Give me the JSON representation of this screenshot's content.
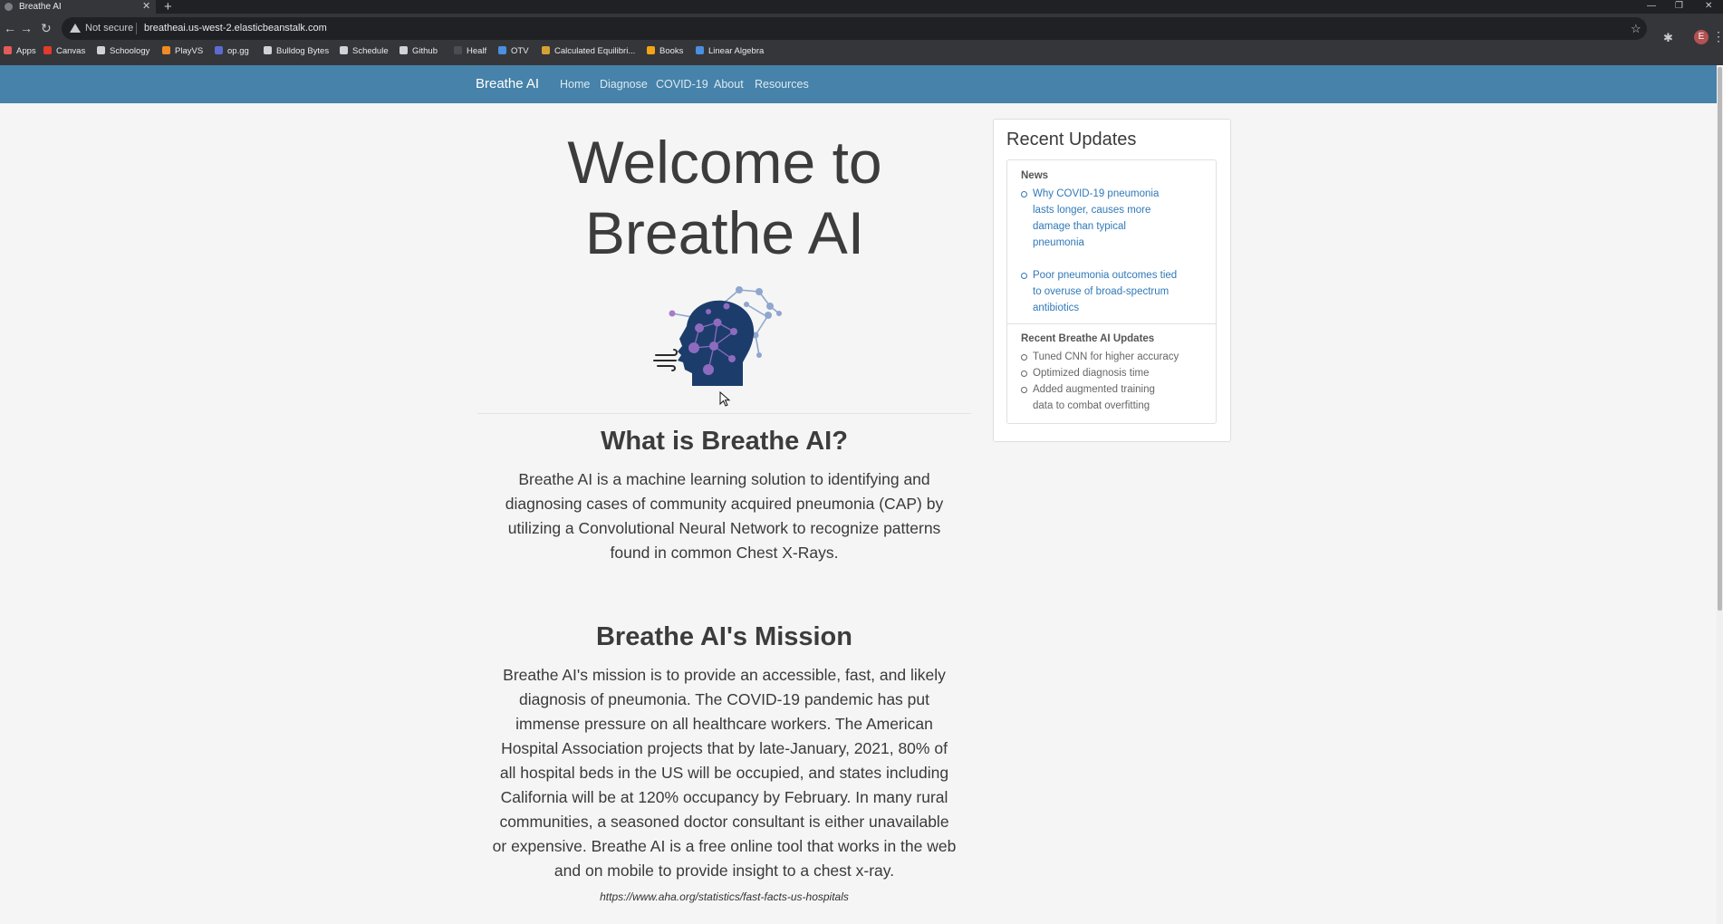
{
  "browser": {
    "tab_title": "Breathe AI",
    "tab_close": "✕",
    "new_tab": "+",
    "url_warning": "Not secure",
    "url": "breatheai.us-west-2.elasticbeanstalk.com",
    "profile_initial": "E",
    "bookmarks": [
      {
        "label": "Apps",
        "color": "#e45b5b"
      },
      {
        "label": "Canvas",
        "color": "#e13b2c"
      },
      {
        "label": "Schoology",
        "color": "#cfd3d8"
      },
      {
        "label": "PlayVS",
        "color": "#f08a24"
      },
      {
        "label": "op.gg",
        "color": "#5d6bd1"
      },
      {
        "label": "Bulldog Bytes",
        "color": "#cfd3d8"
      },
      {
        "label": "Schedule",
        "color": "#cfd3d8"
      },
      {
        "label": "Github",
        "color": "#cfd3d8"
      },
      {
        "label": "Healf",
        "color": "#4a4d52"
      },
      {
        "label": "OTV",
        "color": "#4a8fe0"
      },
      {
        "label": "Calculated Equilibri...",
        "color": "#d6a134"
      },
      {
        "label": "Books",
        "color": "#f2a516"
      },
      {
        "label": "Linear Algebra",
        "color": "#4a8fe0"
      }
    ]
  },
  "nav": {
    "brand": "Breathe AI",
    "links": [
      "Home",
      "Diagnose",
      "COVID-19",
      "About",
      "Resources"
    ]
  },
  "hero": {
    "line1": "Welcome to",
    "line2": "Breathe AI"
  },
  "what": {
    "title": "What is Breathe AI?",
    "lines": [
      "Breathe AI is a machine learning solution to identifying and",
      "diagnosing cases of community acquired pneumonia (CAP) by",
      "utilizing a Convolutional Neural Network to recognize patterns",
      "found in common Chest X-Rays."
    ]
  },
  "mission": {
    "title": "Breathe AI's Mission",
    "lines": [
      "Breathe AI's mission is to provide an accessible, fast, and likely",
      "diagnosis of pneumonia. The COVID-19 pandemic has put",
      "immense pressure on all healthcare workers. The American",
      "Hospital Association projects that by late-January, 2021, 80% of",
      "all hospital beds in the US will be occupied, and states including",
      "California will be at 120% occupancy by February. In many rural",
      "communities, a seasoned doctor consultant is either unavailable",
      "or expensive. Breathe AI is a free online tool that works in the web",
      "and on mobile to provide insight to a chest x-ray."
    ],
    "citation": "https://www.aha.org/statistics/fast-facts-us-hospitals"
  },
  "updates": {
    "title": "Recent Updates",
    "news_label": "News",
    "news": [
      [
        "Why COVID-19 pneumonia",
        "lasts longer, causes more",
        "damage than typical",
        "pneumonia"
      ],
      [
        "Poor pneumonia outcomes tied",
        "to overuse of broad-spectrum",
        "antibiotics"
      ]
    ],
    "ai_label": "Recent Breathe AI Updates",
    "ai_updates": [
      [
        "Tuned CNN for higher accuracy"
      ],
      [
        "Optimized diagnosis time"
      ],
      [
        "Added augmented training",
        "data to combat overfitting"
      ]
    ]
  },
  "colors": {
    "navbar": "#4682a9",
    "link": "#3079b8",
    "background": "#f5f5f5"
  }
}
